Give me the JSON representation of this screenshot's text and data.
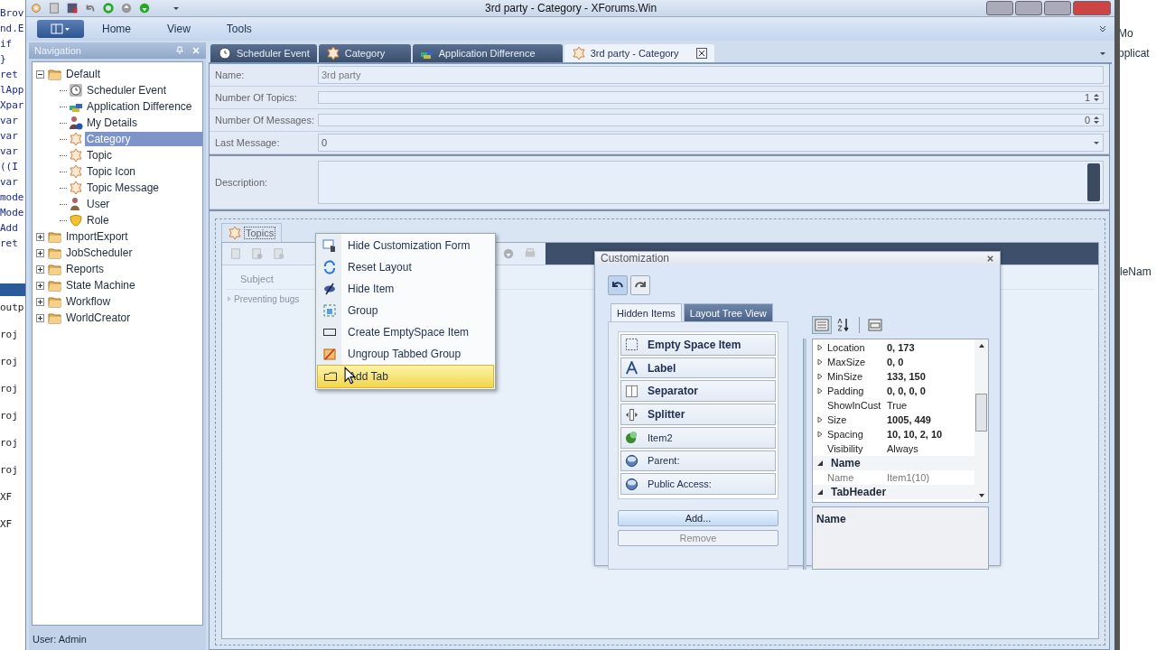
{
  "background": {
    "code_lines": [
      "Brov",
      "nd.E",
      "if",
      "}",
      "ret",
      "lApp",
      "Xpar",
      "var",
      "var",
      "var",
      "((I",
      "var",
      "mode",
      "Mode",
      "Add",
      "ret"
    ],
    "output_lines": [
      "outp",
      "roj",
      "roj",
      "roj",
      "roj",
      "roj",
      "roj",
      "XF",
      "XF"
    ],
    "right_lines": [
      "Mo",
      "pplicat"
    ],
    "right_mid": "leNam"
  },
  "window": {
    "title": "3rd party - Category - XForums.Win"
  },
  "ribbon": {
    "tabs": [
      {
        "label": "Home"
      },
      {
        "label": "View"
      },
      {
        "label": "Tools"
      }
    ]
  },
  "navigation": {
    "title": "Navigation",
    "tree": [
      {
        "label": "Default",
        "kind": "folder",
        "expanded": true,
        "selected": false,
        "children": [
          {
            "label": "Scheduler Event",
            "kind": "clock",
            "selected": false
          },
          {
            "label": "Application Difference",
            "kind": "blocks",
            "selected": false
          },
          {
            "label": "My Details",
            "kind": "person-info",
            "selected": false
          },
          {
            "label": "Category",
            "kind": "gear",
            "selected": true
          },
          {
            "label": "Topic",
            "kind": "gear",
            "selected": false
          },
          {
            "label": "Topic Icon",
            "kind": "gear",
            "selected": false
          },
          {
            "label": "Topic Message",
            "kind": "gear",
            "selected": false
          },
          {
            "label": "User",
            "kind": "person",
            "selected": false
          },
          {
            "label": "Role",
            "kind": "mask",
            "selected": false
          }
        ]
      },
      {
        "label": "ImportExport",
        "kind": "folder",
        "expanded": false,
        "selected": false
      },
      {
        "label": "JobScheduler",
        "kind": "folder",
        "expanded": false,
        "selected": false
      },
      {
        "label": "Reports",
        "kind": "folder",
        "expanded": false,
        "selected": false
      },
      {
        "label": "State Machine",
        "kind": "folder",
        "expanded": false,
        "selected": false
      },
      {
        "label": "Workflow",
        "kind": "folder",
        "expanded": false,
        "selected": false
      },
      {
        "label": "WorldCreator",
        "kind": "folder",
        "expanded": false,
        "selected": false
      }
    ]
  },
  "status_bar": {
    "text": "User: Admin"
  },
  "doc_tabs": [
    {
      "label": "Scheduler Event",
      "kind": "clock",
      "selected": false
    },
    {
      "label": "Category",
      "kind": "gear",
      "selected": false
    },
    {
      "label": "Application Difference",
      "kind": "blocks",
      "selected": false
    },
    {
      "label": "3rd party - Category",
      "kind": "gear",
      "selected": true
    }
  ],
  "form": {
    "fields": [
      {
        "label": "Name:",
        "kind": "text",
        "value": "3rd party"
      },
      {
        "label": "Number Of Topics:",
        "kind": "spin",
        "value": "1"
      },
      {
        "label": "Number Of Messages:",
        "kind": "spin",
        "value": "0"
      },
      {
        "label": "Last Message:",
        "kind": "combo",
        "value": "0"
      },
      {
        "label": "Description:",
        "kind": "memo"
      }
    ]
  },
  "topics_group": {
    "tab": "Topics",
    "grid": {
      "columns": [
        "Subject"
      ],
      "rows": [
        [
          "Preventing bugs"
        ]
      ]
    }
  },
  "context_menu": {
    "items": [
      {
        "label": "Hide Customization Form",
        "kind": "hide-form",
        "selected": false
      },
      {
        "label": "Reset Layout",
        "kind": "reset",
        "selected": false
      },
      {
        "label": "Hide Item",
        "kind": "hide-item",
        "selected": false
      },
      {
        "label": "Group",
        "kind": "group",
        "selected": false
      },
      {
        "label": "Create EmptySpace Item",
        "kind": "empty",
        "selected": false
      },
      {
        "label": "Ungroup Tabbed Group",
        "kind": "ungroup",
        "selected": false
      },
      {
        "label": "Add Tab",
        "kind": "tab",
        "selected": true
      }
    ]
  },
  "customization": {
    "title": "Customization",
    "tabs": [
      {
        "label": "Hidden Items",
        "selected": true
      },
      {
        "label": "Layout Tree View",
        "selected": false
      }
    ],
    "hidden_items": [
      {
        "label": "Empty Space Item",
        "kind": "empty",
        "bold": true
      },
      {
        "label": "Label",
        "kind": "label",
        "bold": true
      },
      {
        "label": "Separator",
        "kind": "separator",
        "bold": true
      },
      {
        "label": "Splitter",
        "kind": "splitter",
        "bold": true
      },
      {
        "label": "Item2",
        "kind": "item",
        "bold": false
      },
      {
        "label": "Parent:",
        "kind": "field",
        "bold": false
      },
      {
        "label": "Public Access:",
        "kind": "field",
        "bold": false
      }
    ],
    "buttons": [
      "Add...",
      "Remove"
    ],
    "properties": [
      {
        "kind": "property",
        "name": "Location",
        "value": "0, 173",
        "bold": true,
        "expandable": true
      },
      {
        "kind": "property",
        "name": "MaxSize",
        "value": "0, 0",
        "bold": true,
        "expandable": true
      },
      {
        "kind": "property",
        "name": "MinSize",
        "value": "133, 150",
        "bold": true,
        "expandable": true
      },
      {
        "kind": "property",
        "name": "Padding",
        "value": "0, 0, 0, 0",
        "bold": true,
        "expandable": true
      },
      {
        "kind": "property",
        "name": "ShowInCust",
        "value": "True",
        "bold": false,
        "expandable": false
      },
      {
        "kind": "property",
        "name": "Size",
        "value": "1005, 449",
        "bold": true,
        "expandable": true
      },
      {
        "kind": "property",
        "name": "Spacing",
        "value": "10, 10, 2, 10",
        "bold": true,
        "expandable": true
      },
      {
        "kind": "property",
        "name": "Visibility",
        "value": "Always",
        "bold": false,
        "expandable": false
      },
      {
        "kind": "category",
        "name": "Name"
      },
      {
        "kind": "readonly",
        "name": "Name",
        "value": "Item1(10)",
        "bold": false,
        "expandable": false
      },
      {
        "kind": "category",
        "name": "TabHeader"
      }
    ],
    "description": "Name"
  }
}
